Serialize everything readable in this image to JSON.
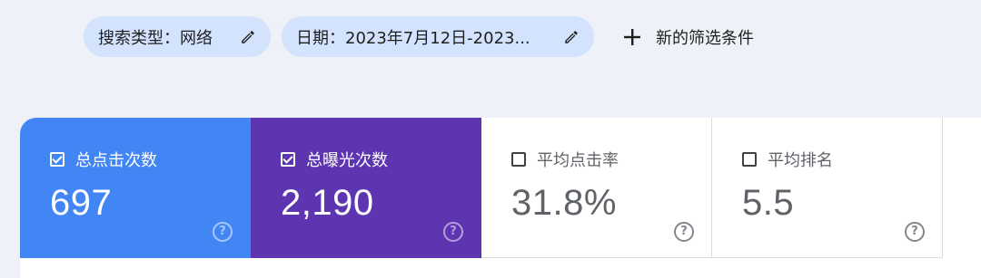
{
  "filters": {
    "chips": [
      {
        "label": "搜索类型：网络",
        "icon": "pencil-icon"
      },
      {
        "label": "日期：2023年7月12日-2023...",
        "icon": "pencil-icon"
      }
    ],
    "new_filter_label": "新的筛选条件"
  },
  "metrics": [
    {
      "label": "总点击次数",
      "value": "697",
      "checked": true,
      "color": "#4285f4"
    },
    {
      "label": "总曝光次数",
      "value": "2,190",
      "checked": true,
      "color": "#5e35b1"
    },
    {
      "label": "平均点击率",
      "value": "31.8%",
      "checked": false,
      "color": "#ffffff"
    },
    {
      "label": "平均排名",
      "value": "5.5",
      "checked": false,
      "color": "#ffffff"
    }
  ],
  "help_glyph": "?"
}
